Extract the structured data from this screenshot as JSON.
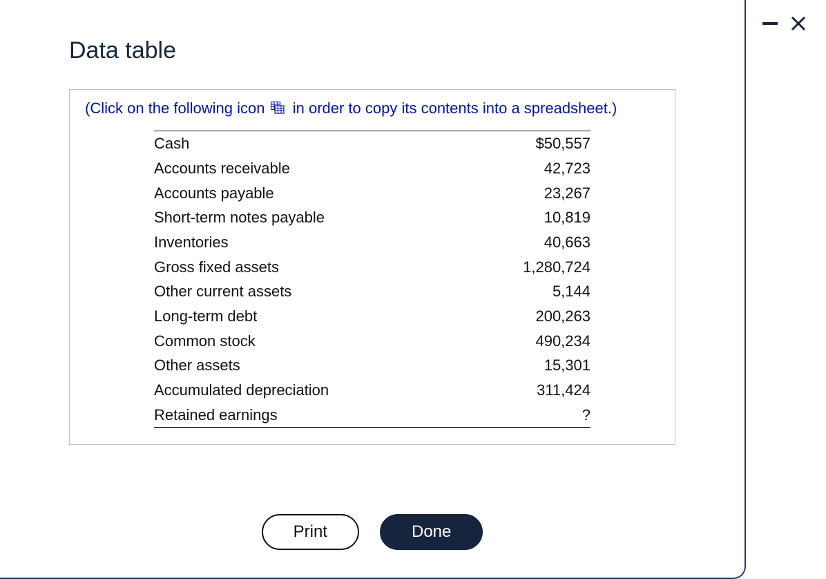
{
  "title": "Data table",
  "instruction_prefix": "(Click on the following icon",
  "instruction_suffix": "in order to copy its contents into a spreadsheet.)",
  "rows": [
    {
      "label": "Cash",
      "value": "$50,557"
    },
    {
      "label": "Accounts receivable",
      "value": "42,723"
    },
    {
      "label": "Accounts payable",
      "value": "23,267"
    },
    {
      "label": "Short-term notes payable",
      "value": "10,819"
    },
    {
      "label": "Inventories",
      "value": "40,663"
    },
    {
      "label": "Gross fixed assets",
      "value": "1,280,724"
    },
    {
      "label": "Other current assets",
      "value": "5,144"
    },
    {
      "label": "Long-term debt",
      "value": "200,263"
    },
    {
      "label": "Common stock",
      "value": "490,234"
    },
    {
      "label": "Other assets",
      "value": "15,301"
    },
    {
      "label": "Accumulated depreciation",
      "value": "311,424"
    },
    {
      "label": "Retained earnings",
      "value": "?"
    }
  ],
  "buttons": {
    "print": "Print",
    "done": "Done"
  }
}
